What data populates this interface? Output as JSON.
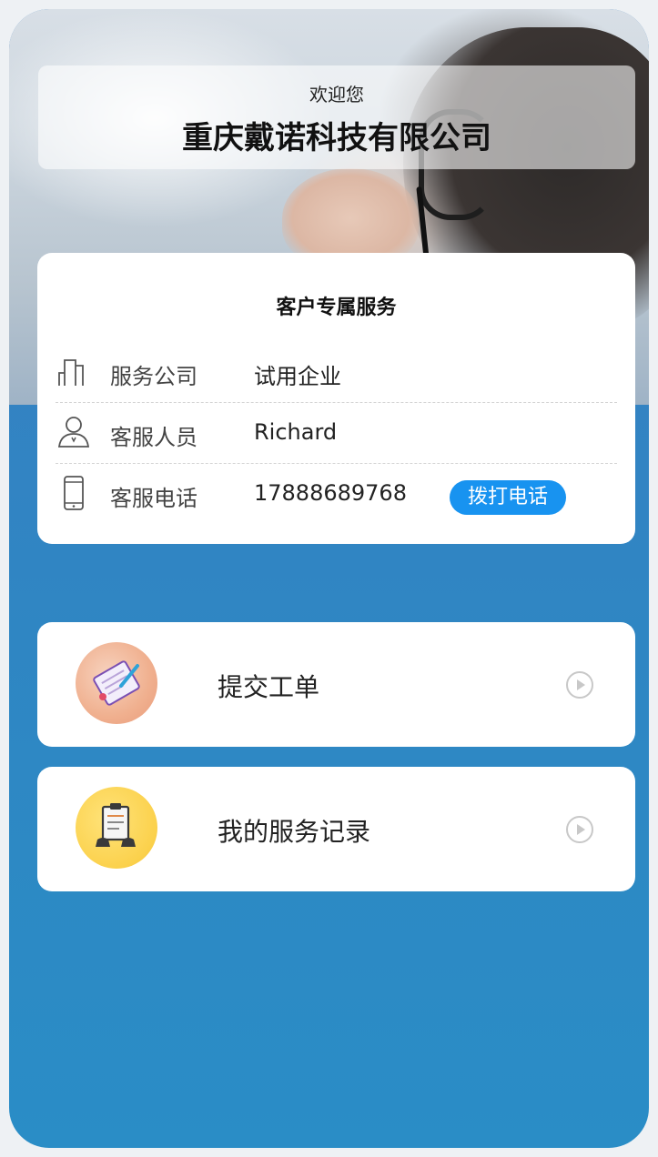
{
  "header": {
    "welcome": "欢迎您",
    "company_name": "重庆戴诺科技有限公司"
  },
  "service_card": {
    "title": "客户专属服务",
    "rows": [
      {
        "icon": "building-icon",
        "label": "服务公司",
        "value": "试用企业"
      },
      {
        "icon": "person-icon",
        "label": "客服人员",
        "value": "Richard"
      },
      {
        "icon": "phone-icon",
        "label": "客服电话",
        "value": "17888689768"
      }
    ],
    "call_button": "拨打电话"
  },
  "actions": [
    {
      "icon": "ticket-icon",
      "label": "提交工单"
    },
    {
      "icon": "clipboard-icon",
      "label": "我的服务记录"
    }
  ],
  "colors": {
    "accent": "#1893f0",
    "background": "#2f86c3",
    "card": "#ffffff"
  }
}
